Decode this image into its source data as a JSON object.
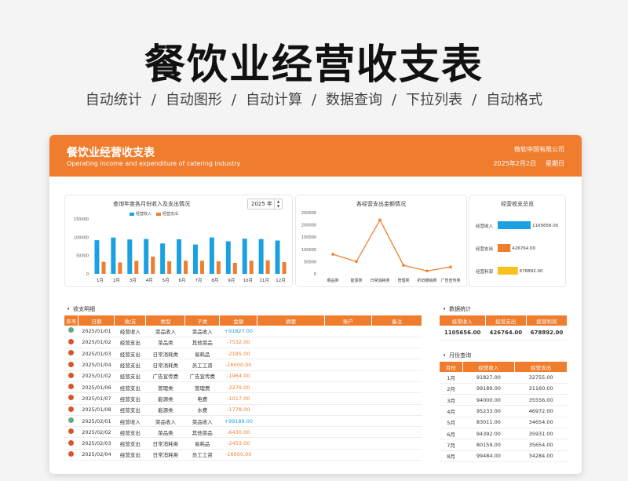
{
  "hero": {
    "title": "餐饮业经营收支表",
    "features": [
      "自动统计",
      "/",
      "自动图形",
      "/",
      "自动计算",
      "/",
      "数据查询",
      "/",
      "下拉列表",
      "/",
      "自动格式"
    ]
  },
  "sheet": {
    "title": "餐饮业经营收支表",
    "subtitle": "Operating income and expenditure of catering industry",
    "company": "微软中国有限公司",
    "date": "2025年2月2日",
    "weekday": "星期日"
  },
  "colors": {
    "accent": "#f07d2e",
    "income": "#1ba1e2",
    "profit": "#f7c21b",
    "dot_income": "#6aa77c",
    "dot_expense": "#d9532b"
  },
  "chart_data": [
    {
      "type": "bar",
      "title": "查询年度各月份收入及支出情况",
      "year_select": "2025 年",
      "categories": [
        "1月",
        "2月",
        "3月",
        "4月",
        "5月",
        "6月",
        "7月",
        "8月",
        "9月",
        "10月",
        "11月",
        "12月"
      ],
      "series": [
        {
          "name": "经营收入",
          "values": [
            91827,
            99189,
            94000,
            95233,
            83011,
            94392,
            80159,
            99484,
            89000,
            96000,
            95000,
            91000
          ]
        },
        {
          "name": "经营支出",
          "values": [
            32755,
            31160,
            35556,
            46972,
            34654,
            35931,
            35654,
            34284,
            30000,
            36000,
            37000,
            32000
          ]
        }
      ],
      "yticks": [
        "0",
        "50000",
        "100000",
        "150000"
      ],
      "ylim": [
        0,
        150000
      ]
    },
    {
      "type": "line",
      "title": "各经营支出金额情况",
      "categories": [
        "菜品类",
        "能源类",
        "日常消耗类",
        "管理类",
        "折旧摊销类",
        "广告宣传类"
      ],
      "values": [
        80000,
        50000,
        220000,
        35000,
        12000,
        28000
      ],
      "yticks": [
        "0",
        "50000",
        "100000",
        "150000",
        "200000",
        "250000"
      ],
      "ylim": [
        0,
        250000
      ]
    },
    {
      "type": "bar",
      "title": "经营收支总览",
      "categories": [
        "经营收入",
        "经营支出",
        "经营利润"
      ],
      "values": [
        1105656.0,
        426764.0,
        678892.0
      ],
      "labels": [
        "1105656.00",
        "426764.00",
        "678892.00"
      ]
    }
  ],
  "detail": {
    "label": "收支明细",
    "headers": [
      "序号",
      "日期",
      "收/支",
      "类型",
      "子类",
      "金额",
      "摘要",
      "账户",
      "备注"
    ],
    "rows": [
      {
        "kind": "in",
        "date": "2025/01/01",
        "io": "经营收入",
        "type": "菜品收入",
        "sub": "菜品收入",
        "amount": "+91827.00"
      },
      {
        "kind": "out",
        "date": "2025/01/02",
        "io": "经营支出",
        "type": "菜品类",
        "sub": "其他菜品",
        "amount": "-7532.00"
      },
      {
        "kind": "out",
        "date": "2025/01/03",
        "io": "经营支出",
        "type": "日常消耗类",
        "sub": "易耗品",
        "amount": "-2185.00"
      },
      {
        "kind": "out",
        "date": "2025/01/04",
        "io": "经营支出",
        "type": "日常消耗类",
        "sub": "员工工资",
        "amount": "-16000.00"
      },
      {
        "kind": "out",
        "date": "2025/01/02",
        "io": "经营支出",
        "type": "广告宣传费",
        "sub": "广告宣传费",
        "amount": "-1964.00"
      },
      {
        "kind": "out",
        "date": "2025/01/06",
        "io": "经营支出",
        "type": "管理类",
        "sub": "管理费",
        "amount": "-2279.00"
      },
      {
        "kind": "out",
        "date": "2025/01/07",
        "io": "经营支出",
        "type": "能源类",
        "sub": "电费",
        "amount": "-1017.00"
      },
      {
        "kind": "out",
        "date": "2025/01/08",
        "io": "经营支出",
        "type": "能源类",
        "sub": "水费",
        "amount": "-1778.00"
      },
      {
        "kind": "in",
        "date": "2025/02/01",
        "io": "经营收入",
        "type": "菜品收入",
        "sub": "菜品收入",
        "amount": "+99189.00"
      },
      {
        "kind": "out",
        "date": "2025/02/02",
        "io": "经营支出",
        "type": "菜品类",
        "sub": "其他菜品",
        "amount": "-6430.00"
      },
      {
        "kind": "out",
        "date": "2025/02/03",
        "io": "经营支出",
        "type": "日常消耗类",
        "sub": "易耗品",
        "amount": "-2453.00"
      },
      {
        "kind": "out",
        "date": "2025/02/04",
        "io": "经营支出",
        "type": "日常消耗类",
        "sub": "员工工资",
        "amount": "-16000.00"
      }
    ]
  },
  "stats": {
    "label": "数据统计",
    "headers": [
      "经营收入",
      "经营支出",
      "经营利润"
    ],
    "values": [
      "1105656.00",
      "426764.00",
      "678892.00"
    ]
  },
  "monthly": {
    "label": "月份查询",
    "headers": [
      "月份",
      "经营收入",
      "经营支出"
    ],
    "rows": [
      [
        "1月",
        "91827.00",
        "32755.00"
      ],
      [
        "2月",
        "99189.00",
        "31160.00"
      ],
      [
        "3月",
        "94000.00",
        "35556.00"
      ],
      [
        "4月",
        "95233.00",
        "46972.00"
      ],
      [
        "5月",
        "83011.00",
        "34654.00"
      ],
      [
        "6月",
        "94392.00",
        "35931.00"
      ],
      [
        "7月",
        "80159.00",
        "35654.00"
      ],
      [
        "8月",
        "99484.00",
        "34284.00"
      ]
    ]
  }
}
